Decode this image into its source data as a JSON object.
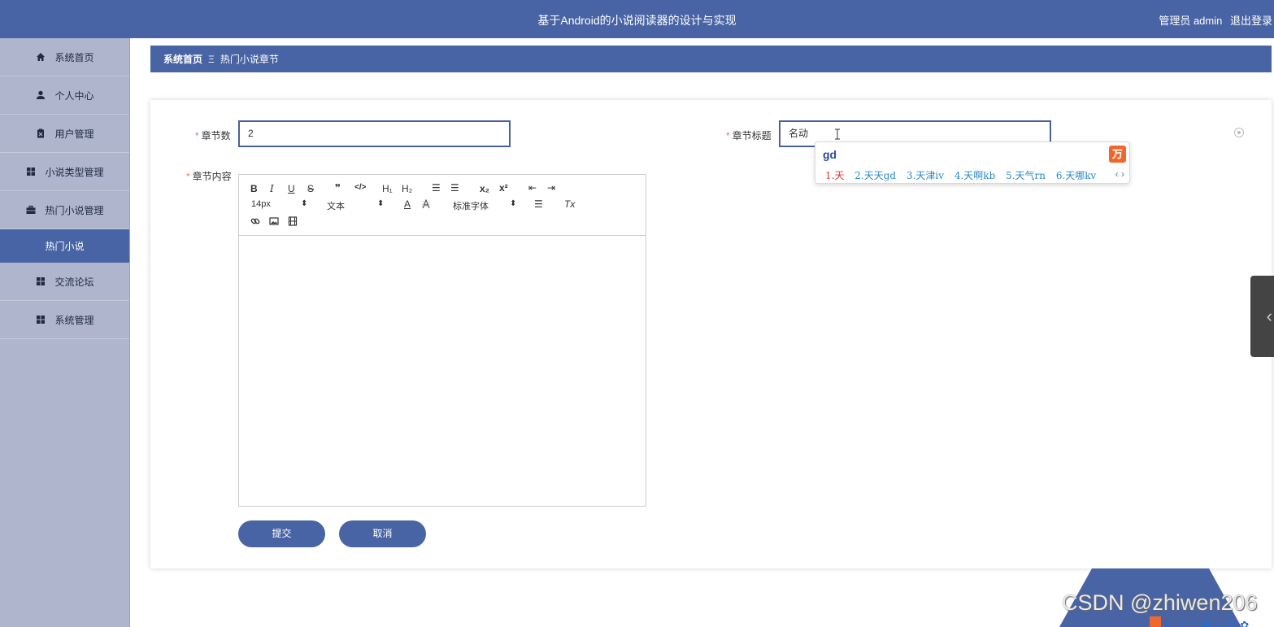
{
  "header": {
    "title": "基于Android的小说阅读器的设计与实现",
    "user_label": "管理员 admin",
    "logout": "退出登录"
  },
  "sidebar": {
    "items": [
      {
        "label": "系统首页",
        "icon": "home-icon"
      },
      {
        "label": "个人中心",
        "icon": "person-icon"
      },
      {
        "label": "用户管理",
        "icon": "clipboard-icon"
      },
      {
        "label": "小说类型管理",
        "icon": "grid-icon"
      },
      {
        "label": "热门小说管理",
        "icon": "briefcase-icon"
      },
      {
        "label": "热门小说",
        "icon": ""
      },
      {
        "label": "交流论坛",
        "icon": "grid-icon"
      },
      {
        "label": "系统管理",
        "icon": "grid-icon"
      }
    ]
  },
  "breadcrumb": {
    "home": "系统首页",
    "separator": "Ξ",
    "current": "热门小说章节"
  },
  "form": {
    "chapter_num_label": "章节数",
    "chapter_num_value": "2",
    "chapter_title_label": "章节标题",
    "chapter_title_value": "名动",
    "content_label": "章节内容",
    "required_mark": "*"
  },
  "editor": {
    "bold": "B",
    "italic": "I",
    "underline": "U",
    "strike": "S",
    "quote": "❞",
    "code": "</>",
    "h1": "H₁",
    "h2": "H₂",
    "ordered_list": "☰",
    "bullet_list": "☰",
    "subscript": "x₂",
    "superscript": "x²",
    "outdent": "⇤",
    "indent": "⇥",
    "font_size": "14px",
    "text_type": "文本",
    "font_color": "A",
    "font_family": "标准字体",
    "align": "☰",
    "clear_format": "Tx",
    "select_arrow": "⬍"
  },
  "buttons": {
    "submit": "提交",
    "cancel": "取消"
  },
  "ime": {
    "code": "gd",
    "logo": "万",
    "candidates": [
      "1.天",
      "2.天天gd",
      "3.天津iv",
      "4.天啊kb",
      "5.天气rn",
      "6.天哪kv"
    ],
    "arrows": "‹ ›"
  },
  "overlay": {
    "watermark": "CSDN @zhiwen206",
    "ime_bar": "中 ノ °, ▦ ⚇ 简 ✿"
  },
  "colors": {
    "primary": "#4964a4",
    "sidebar_bg": "#aeb5cd",
    "required": "#f56c6c",
    "ime_candidate": "#2a8ac8",
    "ime_first": "#e03131"
  }
}
